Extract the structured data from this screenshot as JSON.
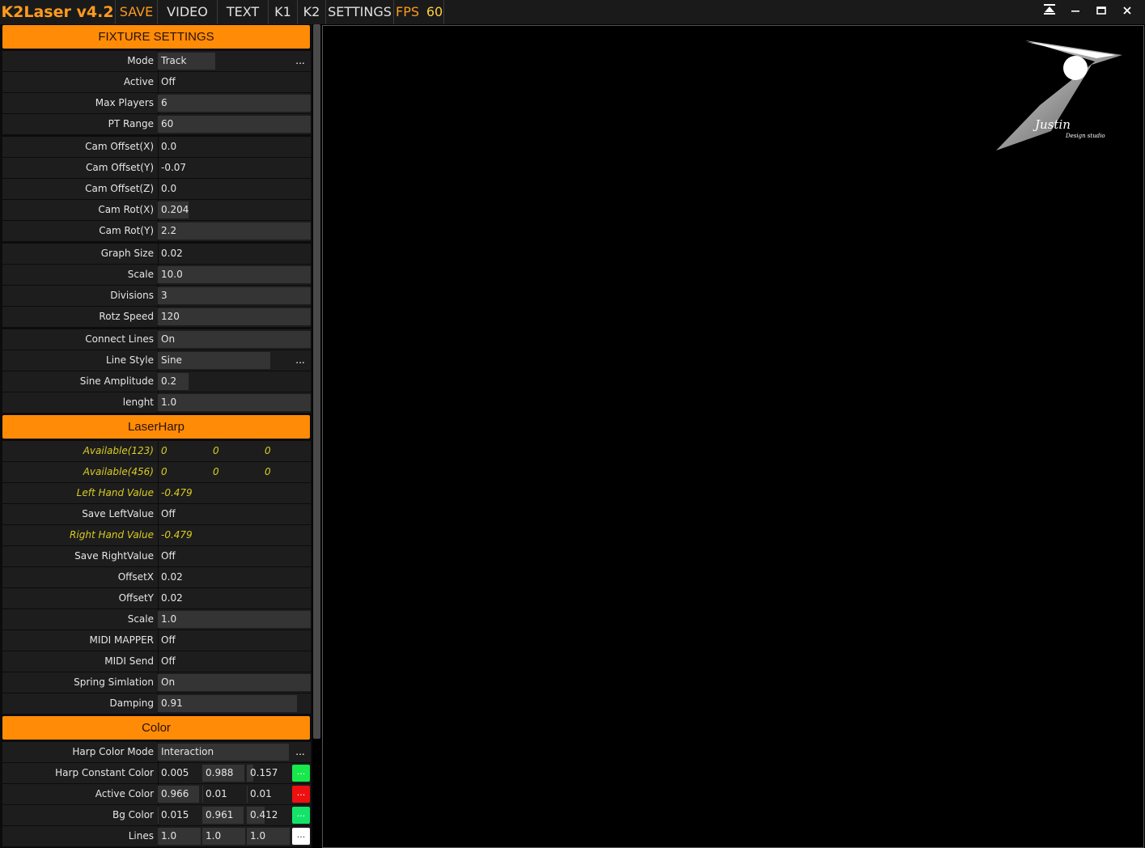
{
  "menubar": {
    "app_title": "K2Laser v4.2",
    "items": [
      "SAVE",
      "VIDEO",
      "TEXT",
      "K1",
      "K2",
      "SETTINGS"
    ],
    "fps_label": "FPS",
    "fps_value": "60",
    "window_buttons": {
      "pin": "⏶",
      "minimize": "—",
      "maximize": "▭",
      "close": "✕"
    }
  },
  "fixture": {
    "title": "FIXTURE SETTINGS",
    "rows": [
      {
        "label": "Mode",
        "value": "Track",
        "fill": 0.44,
        "more": "..."
      },
      {
        "label": "Active",
        "value": "Off",
        "fill": 0
      },
      {
        "label": "Max Players",
        "value": "6",
        "fill": 1.0
      },
      {
        "label": "PT Range",
        "value": "60",
        "fill": 1.0
      },
      {
        "label": "Cam Offset(X)",
        "value": "0.0",
        "fill": 0
      },
      {
        "label": "Cam Offset(Y)",
        "value": "-0.07",
        "fill": 0
      },
      {
        "label": "Cam Offset(Z)",
        "value": "0.0",
        "fill": 0
      },
      {
        "label": "Cam Rot(X)",
        "value": "0.204",
        "fill": 0.2
      },
      {
        "label": "Cam Rot(Y)",
        "value": "2.2",
        "fill": 1.0
      },
      {
        "label": "Graph Size",
        "value": "0.02",
        "fill": 0
      },
      {
        "label": "Scale",
        "value": "10.0",
        "fill": 1.0
      },
      {
        "label": "Divisions",
        "value": "3",
        "fill": 1.0
      },
      {
        "label": "Rotz Speed",
        "value": "120",
        "fill": 1.0
      },
      {
        "label": "Connect Lines",
        "value": "On",
        "fill": 1.0
      },
      {
        "label": "Line Style",
        "value": "Sine",
        "fill": 0.86,
        "more": "..."
      },
      {
        "label": "Sine Amplitude",
        "value": "0.2",
        "fill": 0.2
      },
      {
        "label": "lenght",
        "value": "1.0",
        "fill": 1.0
      }
    ]
  },
  "laserharp": {
    "title": "LaserHarp",
    "available_123": {
      "label": "Available(123)",
      "values": [
        "0",
        "0",
        "0"
      ]
    },
    "available_456": {
      "label": "Available(456)",
      "values": [
        "0",
        "0",
        "0"
      ]
    },
    "left_hand": {
      "label": "Left Hand Value",
      "value": "-0.479"
    },
    "save_left": {
      "label": "Save LeftValue",
      "value": "Off"
    },
    "right_hand": {
      "label": "Right Hand Value",
      "value": "-0.479"
    },
    "save_right": {
      "label": "Save RightValue",
      "value": "Off"
    },
    "rows": [
      {
        "label": "OffsetX",
        "value": "0.02",
        "fill": 0
      },
      {
        "label": "OffsetY",
        "value": "0.02",
        "fill": 0
      },
      {
        "label": "Scale",
        "value": "1.0",
        "fill": 1.0
      },
      {
        "label": "MIDI MAPPER",
        "value": "Off",
        "fill": 0
      },
      {
        "label": "MIDI Send",
        "value": "Off",
        "fill": 0
      },
      {
        "label": "Spring Simlation",
        "value": "On",
        "fill": 1.0
      },
      {
        "label": "Damping",
        "value": "0.91",
        "fill": 0.91
      }
    ]
  },
  "color": {
    "title": "Color",
    "mode": {
      "label": "Harp Color Mode",
      "value": "Interaction",
      "more": "..."
    },
    "rows": [
      {
        "label": "Harp Constant Color",
        "values": [
          "0.005",
          "0.988",
          "0.157"
        ],
        "swatch": "#17e84c",
        "more": "..."
      },
      {
        "label": "Active Color",
        "values": [
          "0.966",
          "0.01",
          "0.01"
        ],
        "swatch": "#ee1010",
        "more": "..."
      },
      {
        "label": "Bg Color",
        "values": [
          "0.015",
          "0.961",
          "0.412"
        ],
        "swatch": "#14e36a",
        "more": "..."
      },
      {
        "label": "Lines",
        "values": [
          "1.0",
          "1.0",
          "1.0"
        ],
        "swatch": "#ffffff",
        "more": "..."
      }
    ]
  },
  "viewport": {
    "logo_script_text": "Justin",
    "logo_sub_text": "Design studio"
  },
  "colors": {
    "accent": "#ff8b07",
    "highlight_text": "#d9cc21",
    "row_bg": "#1d1d1d"
  }
}
